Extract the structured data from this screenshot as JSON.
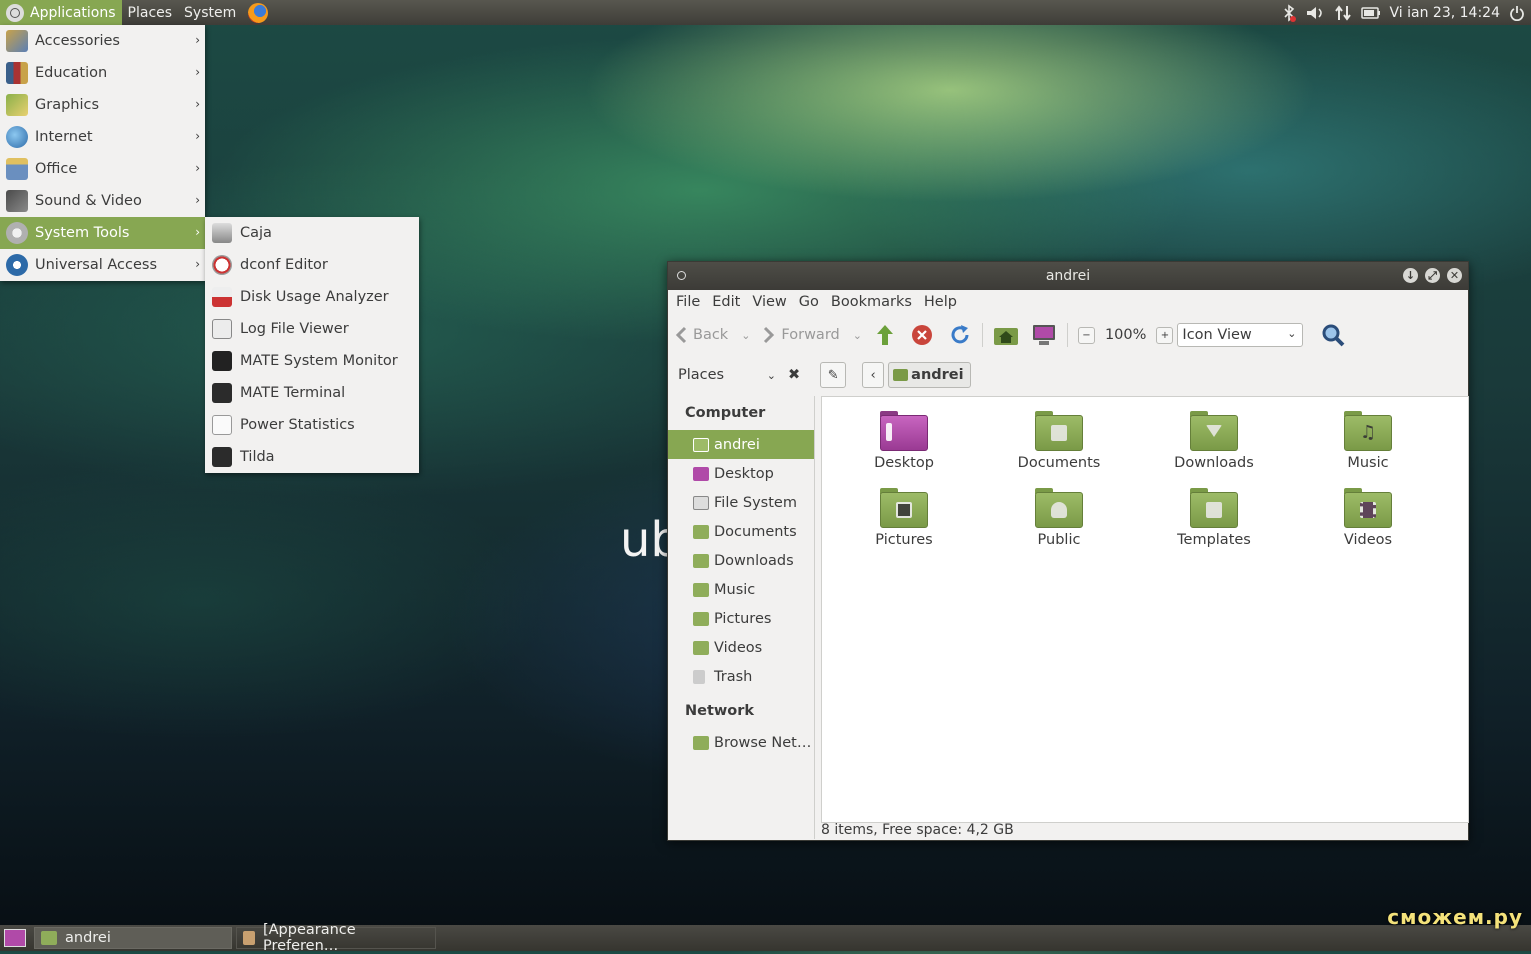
{
  "top_panel": {
    "menus": [
      "Applications",
      "Places",
      "System"
    ],
    "clock": "Vi ian 23, 14:24"
  },
  "app_menu": {
    "items": [
      {
        "label": "Accessories",
        "icon": "accessories-icon"
      },
      {
        "label": "Education",
        "icon": "education-icon"
      },
      {
        "label": "Graphics",
        "icon": "graphics-icon"
      },
      {
        "label": "Internet",
        "icon": "internet-icon"
      },
      {
        "label": "Office",
        "icon": "office-icon"
      },
      {
        "label": "Sound & Video",
        "icon": "sound-video-icon"
      },
      {
        "label": "System Tools",
        "icon": "system-tools-icon"
      },
      {
        "label": "Universal Access",
        "icon": "universal-access-icon"
      }
    ],
    "selected": "System Tools"
  },
  "system_tools_menu": {
    "items": [
      {
        "label": "Caja"
      },
      {
        "label": "dconf Editor"
      },
      {
        "label": "Disk Usage Analyzer"
      },
      {
        "label": "Log File Viewer"
      },
      {
        "label": "MATE System Monitor"
      },
      {
        "label": "MATE Terminal"
      },
      {
        "label": "Power Statistics"
      },
      {
        "label": "Tilda"
      }
    ]
  },
  "desktop": {
    "text": "ub"
  },
  "window": {
    "title": "andrei",
    "menu": [
      "File",
      "Edit",
      "View",
      "Go",
      "Bookmarks",
      "Help"
    ],
    "toolbar": {
      "back": "Back",
      "forward": "Forward",
      "zoom": "100%",
      "view_mode": "Icon View"
    },
    "location": {
      "places_label": "Places",
      "crumb": "andrei"
    },
    "sidebar": {
      "computer_heading": "Computer",
      "computer_items": [
        "andrei",
        "Desktop",
        "File System",
        "Documents",
        "Downloads",
        "Music",
        "Pictures",
        "Videos",
        "Trash"
      ],
      "network_heading": "Network",
      "network_items": [
        "Browse Net…"
      ],
      "selected": "andrei"
    },
    "files": [
      "Desktop",
      "Documents",
      "Downloads",
      "Music",
      "Pictures",
      "Public",
      "Templates",
      "Videos"
    ],
    "status": "8 items, Free space: 4,2 GB"
  },
  "taskbar": {
    "tasks": [
      "andrei",
      "[Appearance Preferen…"
    ]
  },
  "watermark": "сможем.ру",
  "colors": {
    "accent": "#87a752",
    "panel": "#3e3d38",
    "folder": "#8fad5a"
  }
}
